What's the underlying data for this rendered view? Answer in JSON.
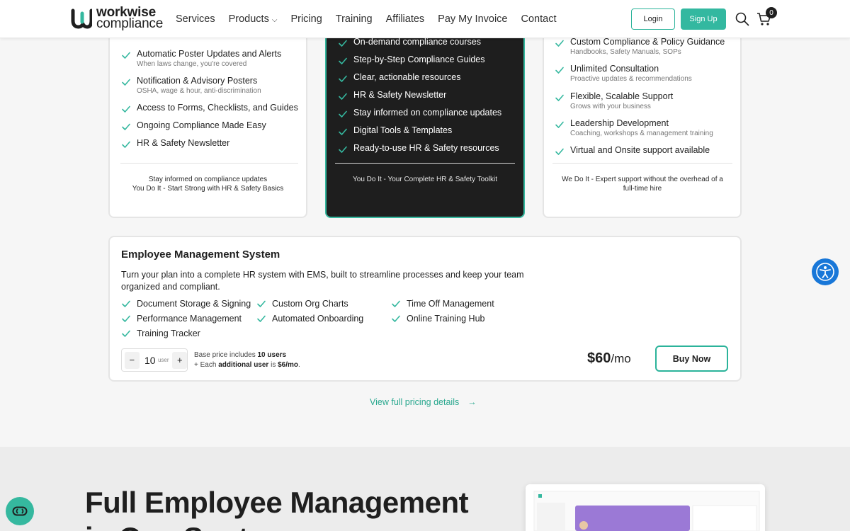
{
  "header": {
    "logo_line1": "workwise",
    "logo_line2": "compliance",
    "nav": [
      "Services",
      "Products",
      "Pricing",
      "Training",
      "Affiliates",
      "Pay My Invoice",
      "Contact"
    ],
    "login": "Login",
    "signup": "Sign Up",
    "cart_count": "0"
  },
  "plan_left": {
    "features": [
      {
        "title": "Automatic Poster Updates and Alerts",
        "sub": "When laws change, you're covered"
      },
      {
        "title": "Notification & Advisory Posters",
        "sub": "OSHA, wage & hour, anti-discrimination"
      },
      {
        "title": "Access to Forms, Checklists, and Guides",
        "sub": ""
      },
      {
        "title": "Ongoing Compliance Made Easy",
        "sub": ""
      },
      {
        "title": "HR & Safety Newsletter",
        "sub": ""
      }
    ],
    "footer_line1": "Stay informed on compliance updates",
    "footer_line2": "You Do It - Start Strong with HR & Safety Basics"
  },
  "plan_mid": {
    "features": [
      "On-demand compliance courses",
      "Step-by-Step Compliance Guides",
      "Clear, actionable resources",
      "HR & Safety Newsletter",
      "Stay informed on compliance updates",
      "Digital Tools & Templates",
      "Ready-to-use HR & Safety resources"
    ],
    "footer": "You Do It - Your Complete HR & Safety Toolkit"
  },
  "plan_right": {
    "features": [
      {
        "title": "Custom Compliance & Policy Guidance",
        "sub": "Handbooks, Safety Manuals, SOPs"
      },
      {
        "title": "Unlimited Consultation",
        "sub": "Proactive updates & recommendations"
      },
      {
        "title": "Flexible, Scalable Support",
        "sub": "Grows with your business"
      },
      {
        "title": "Leadership Development",
        "sub": "Coaching, workshops & management training"
      },
      {
        "title": "Virtual and Onsite support available",
        "sub": ""
      }
    ],
    "footer_line1": "We Do It - Expert support without the overhead of a",
    "footer_line2": "full-time hire"
  },
  "ems": {
    "title": "Employee Management System",
    "description": "Turn your plan into a complete HR system with EMS, built to streamline processes and keep your team organized and compliant.",
    "features": [
      "Document Storage & Signing",
      "Custom Org Charts",
      "Time Off Management",
      "Performance Management",
      "Automated Onboarding",
      "Online Training Hub",
      "Training Tracker"
    ],
    "stepper_minus": "−",
    "stepper_value": "10",
    "stepper_unit": "user",
    "stepper_plus": "+",
    "note_prefix1": "Base price includes ",
    "note_bold1": "10 users",
    "note_prefix2": "+ Each ",
    "note_bold2": "additional user",
    "note_mid2": " is ",
    "note_bold3": "$6/mo",
    "note_end2": ".",
    "price": "$60",
    "price_unit": "/mo",
    "buy": "Buy Now"
  },
  "view_link": "View full pricing details",
  "hero": {
    "title_line1": "Full Employee Management",
    "title_line2": "in One Spot"
  },
  "colors": {
    "accent": "#33b8a0",
    "dark_card": "#1e1e1e",
    "a11y_blue": "#1877d8"
  }
}
